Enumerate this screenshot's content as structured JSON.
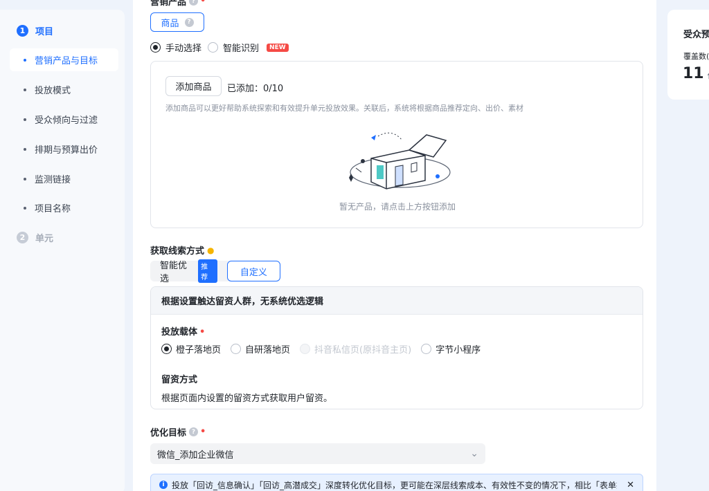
{
  "sidebar": {
    "step1": {
      "num": "1",
      "label": "项目"
    },
    "items": [
      {
        "label": "营销产品与目标"
      },
      {
        "label": "投放模式"
      },
      {
        "label": "受众倾向与过滤"
      },
      {
        "label": "排期与预算出价"
      },
      {
        "label": "监测链接"
      },
      {
        "label": "项目名称"
      }
    ],
    "step2": {
      "num": "2",
      "label": "单元"
    }
  },
  "product": {
    "title": "营销产品",
    "type_button": "商品",
    "help": "?",
    "modes": [
      {
        "label": "手动选择",
        "selected": true
      },
      {
        "label": "智能识别",
        "selected": false
      }
    ],
    "new_badge": "NEW",
    "add_button": "添加商品",
    "added_count": "已添加：0/10",
    "hint": "添加商品可以更好帮助系统探索和有效提升单元投放效果。关联后，系统将根据商品推荐定向、出价、素材",
    "empty_text": "暂无产品，请点击上方按钮添加"
  },
  "leads": {
    "title": "获取线索方式",
    "tabs": [
      {
        "label": "智能优选",
        "badge": "推荐"
      },
      {
        "label": "自定义"
      }
    ],
    "panel_header": "根据设置触达留资人群，无系统优选逻辑",
    "carrier_title": "投放载体",
    "carriers": [
      {
        "label": "橙子落地页",
        "state": "selected"
      },
      {
        "label": "自研落地页",
        "state": "normal"
      },
      {
        "label": "抖音私信页(原抖音主页)",
        "state": "disabled"
      },
      {
        "label": "字节小程序",
        "state": "normal"
      }
    ],
    "method_title": "留资方式",
    "method_desc": "根据页面内设置的留资方式获取用户留资。"
  },
  "optimize": {
    "title": "优化目标",
    "help": "?",
    "value": "微信_添加企业微信",
    "chevron": "⌄"
  },
  "notice": {
    "icon": "i",
    "text": "投放「回访_信息确认」「回访_高潜成交」深度转化优化目标，更可能在深层线索成本、有效性不变的情况下，相比「表单提交」、「私",
    "close": "✕"
  },
  "right_card": {
    "title": "受众预",
    "label": "覆盖数(",
    "value": "11",
    "unit": "亿"
  },
  "colors": {
    "accent": "#1f6fff",
    "danger": "#f54a45",
    "background": "#eef3fb"
  }
}
